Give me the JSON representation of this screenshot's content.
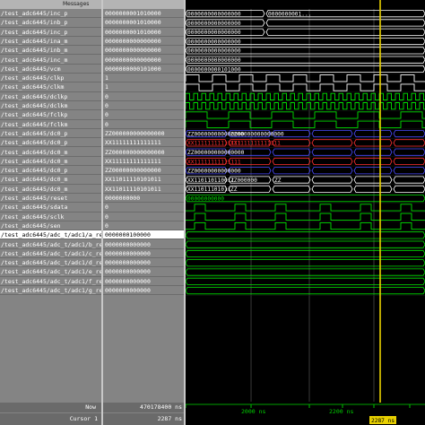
{
  "messages_header": "Messages",
  "signals": [
    {
      "name": "/test_adc6445/inc_p",
      "value": "0000000001010000",
      "kind": "bus",
      "color": "#ffffff",
      "labels": [
        "0000000000000000",
        "0000000001..."
      ]
    },
    {
      "name": "/test_adc6445/inb_p",
      "value": "0000000001010000",
      "kind": "bus",
      "color": "#ffffff",
      "labels": [
        "0000000000000000"
      ]
    },
    {
      "name": "/test_adc6445/inc_p",
      "value": "0000000001010000",
      "kind": "bus",
      "color": "#ffffff",
      "labels": [
        "0000000000000000"
      ]
    },
    {
      "name": "/test_adc6445/ina_m",
      "value": "0000000000000000",
      "kind": "bus",
      "color": "#ffffff",
      "labels": [
        "0000000000000000"
      ]
    },
    {
      "name": "/test_adc6445/inb_m",
      "value": "0000000000000000",
      "kind": "bus",
      "color": "#ffffff",
      "labels": [
        "0000000000000000"
      ]
    },
    {
      "name": "/test_adc6445/inc_m",
      "value": "0000000000000000",
      "kind": "bus",
      "color": "#ffffff",
      "labels": [
        "0000000000000000"
      ]
    },
    {
      "name": "/test_adc6445/vcm",
      "value": "0000000000101000",
      "kind": "bus",
      "color": "#ffffff",
      "labels": [
        "0000000000101000"
      ]
    },
    {
      "name": "/test_adc6445/clkp",
      "value": "1",
      "kind": "clock",
      "color": "#ffffff",
      "labels": []
    },
    {
      "name": "/test_adc6445/clkm",
      "value": "1",
      "kind": "clock",
      "color": "#ffffff",
      "labels": []
    },
    {
      "name": "/test_adc6445/dclkp",
      "value": "0",
      "kind": "clock",
      "color": "#00e000",
      "labels": []
    },
    {
      "name": "/test_adc6445/dclkm",
      "value": "0",
      "kind": "clock",
      "color": "#00e000",
      "labels": []
    },
    {
      "name": "/test_adc6445/fclkp",
      "value": "0",
      "kind": "clock",
      "color": "#00e000",
      "labels": []
    },
    {
      "name": "/test_adc6445/fclkm",
      "value": "0",
      "kind": "clock",
      "color": "#00e000",
      "labels": []
    },
    {
      "name": "/test_adc6445/dc0_p",
      "value": "ZZ000000000000000",
      "kind": "bus",
      "color": "#4a4aff",
      "labels": [
        "ZZ000000000000000",
        "ZZ00000000000000"
      ]
    },
    {
      "name": "/test_adc6445/dc0_p",
      "value": "XX11111111111111",
      "kind": "bus",
      "color": "#ff3030",
      "labels": [
        "XX11111111111111",
        "XX1111111111111"
      ]
    },
    {
      "name": "/test_adc6445/dc0_m",
      "value": "ZZ000000000000000",
      "kind": "bus",
      "color": "#4a4aff",
      "labels": [
        "ZZ000000000000000"
      ]
    },
    {
      "name": "/test_adc6445/dc0_m",
      "value": "XX11111111111111",
      "kind": "bus",
      "color": "#ff3030",
      "labels": [
        "XX11111111111111"
      ]
    },
    {
      "name": "/test_adc6445/dc0_p",
      "value": "ZZ00000000000000",
      "kind": "bus",
      "color": "#4a4aff",
      "labels": [
        "ZZ00000000000000"
      ]
    },
    {
      "name": "/test_adc6445/dc0_m",
      "value": "XX11011110101011",
      "kind": "bus",
      "color": "#ffffff",
      "labels": [
        "XX110110110011",
        "ZZ000000",
        "ZZ"
      ]
    },
    {
      "name": "/test_adc6445/dc0_m",
      "value": "XX11011110101011",
      "kind": "bus",
      "color": "#ffffff",
      "labels": [
        "XX11011101011",
        "ZZ"
      ]
    },
    {
      "name": "/test_adc6445/reset",
      "value": "0000000000",
      "kind": "bus",
      "color": "#00e000",
      "labels": [
        "00000000000"
      ]
    },
    {
      "name": "/test_adc6445/sdata",
      "value": "0",
      "kind": "pulse",
      "color": "#00e000",
      "labels": []
    },
    {
      "name": "/test_adc6445/sclk",
      "value": "0",
      "kind": "pulse",
      "color": "#00e000",
      "labels": []
    },
    {
      "name": "/test_adc6445/sen",
      "value": "0",
      "kind": "pulse",
      "color": "#00e000",
      "labels": []
    },
    {
      "name": "/test_adc6445/adc_t/adc1/a_reg",
      "value": "0000000100000",
      "kind": "bus",
      "color": "#00e000",
      "labels": []
    },
    {
      "name": "/test_adc6445/adc_t/adc1/b_reg",
      "value": "0000000000000",
      "kind": "bus",
      "color": "#00e000",
      "labels": []
    },
    {
      "name": "/test_adc6445/adc_t/adc1/c_reg",
      "value": "0000000000000",
      "kind": "bus",
      "color": "#00e000",
      "labels": []
    },
    {
      "name": "/test_adc6445/adc_t/adc1/d_reg",
      "value": "0000000000000",
      "kind": "bus",
      "color": "#00e000",
      "labels": []
    },
    {
      "name": "/test_adc6445/adc_t/adc1/e_reg",
      "value": "0000000000000",
      "kind": "bus",
      "color": "#00e000",
      "labels": []
    },
    {
      "name": "/test_adc6445/adc_t/adc1/f_reg",
      "value": "0000000000000",
      "kind": "bus",
      "color": "#00e000",
      "labels": []
    },
    {
      "name": "/test_adc6445/adc_t/adc1/g_reg",
      "value": "0000000000000",
      "kind": "bus",
      "color": "#00e000",
      "labels": []
    }
  ],
  "selected_index": 24,
  "footer": {
    "now_label": "Now",
    "now_value": "470178400 ns",
    "cursor_label": "Cursor 1",
    "cursor_value": "2287 ns",
    "cursor_tag": "2287 ns"
  },
  "timeline": {
    "ticks": [
      "2000 ns",
      "2200 ns"
    ]
  }
}
